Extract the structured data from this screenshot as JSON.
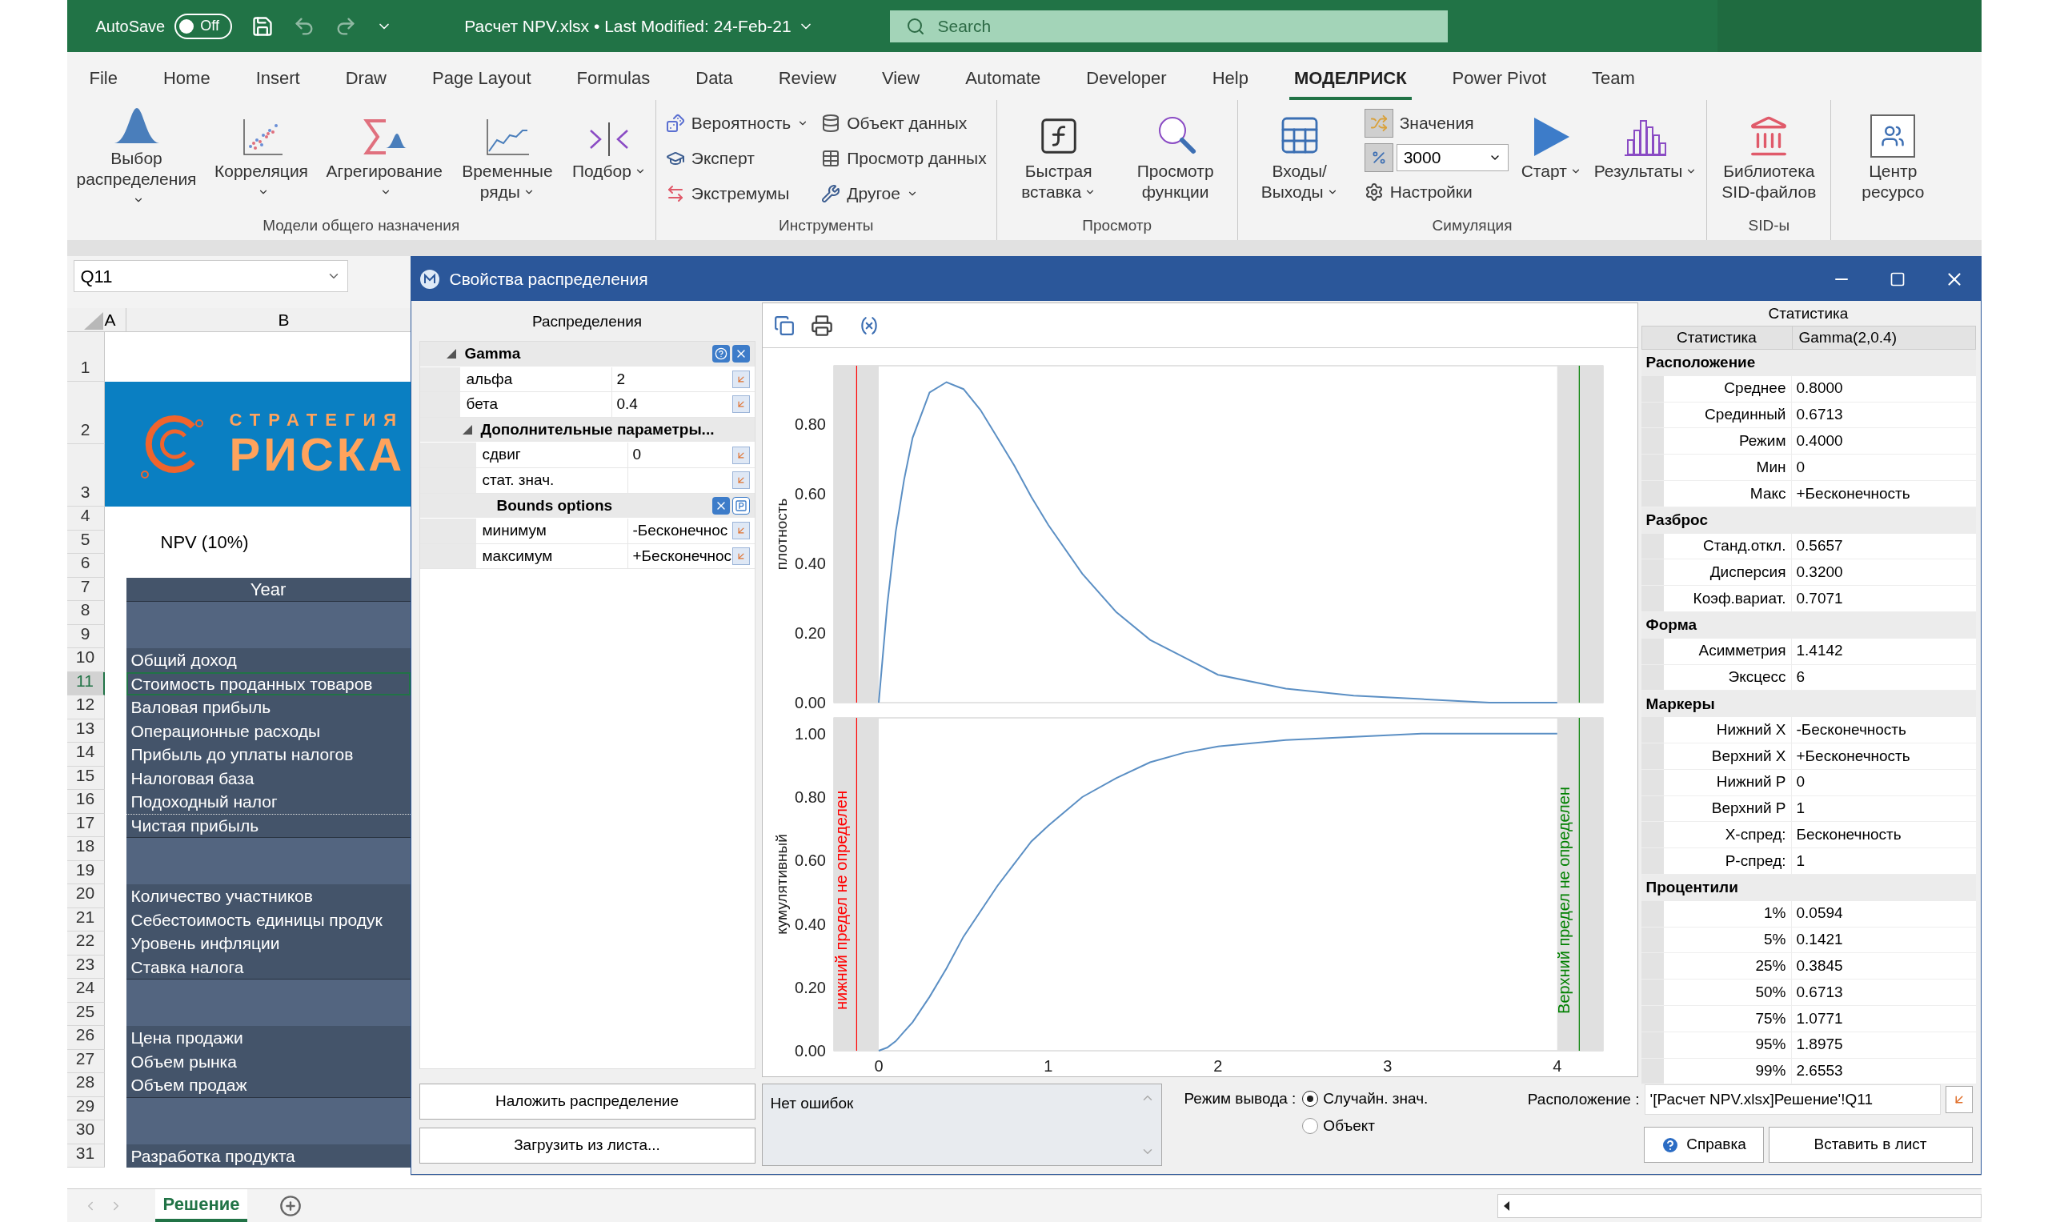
{
  "title_bar": {
    "autosave": {
      "label": "AutoSave",
      "toggle_text": "Off",
      "on": false
    },
    "title": "Расчет NPV.xlsx • Last Modified: 24-Feb-21",
    "search": {
      "placeholder": "Search"
    }
  },
  "menu_tabs": [
    {
      "label": "File",
      "selected": false
    },
    {
      "label": "Home",
      "selected": false
    },
    {
      "label": "Insert",
      "selected": false
    },
    {
      "label": "Draw",
      "selected": false
    },
    {
      "label": "Page Layout",
      "selected": false
    },
    {
      "label": "Formulas",
      "selected": false
    },
    {
      "label": "Data",
      "selected": false
    },
    {
      "label": "Review",
      "selected": false
    },
    {
      "label": "View",
      "selected": false
    },
    {
      "label": "Automate",
      "selected": false
    },
    {
      "label": "Developer",
      "selected": false
    },
    {
      "label": "Help",
      "selected": false
    },
    {
      "label": "МОДЕЛРИСК",
      "selected": true
    },
    {
      "label": "Power Pivot",
      "selected": false
    },
    {
      "label": "Team",
      "selected": false
    }
  ],
  "ribbon": [
    {
      "label": "Модели общего назначения",
      "items": [
        {
          "kind": "large",
          "label": "Выбор распределения",
          "dropdown": true
        },
        {
          "kind": "large",
          "label": "Корреляция",
          "dropdown": true
        },
        {
          "kind": "large",
          "label": "Агрегирование",
          "dropdown": true
        },
        {
          "kind": "large",
          "label": "Временные ряды",
          "dropdown": true
        },
        {
          "kind": "large",
          "label": "Подбор",
          "dropdown": true
        }
      ]
    },
    {
      "label": "Инструменты",
      "items": [
        {
          "kind": "small",
          "label": "Вероятность",
          "dropdown": true
        },
        {
          "kind": "small",
          "label": "Эксперт",
          "dropdown": false
        },
        {
          "kind": "small",
          "label": "Экстремумы",
          "dropdown": false
        },
        {
          "kind": "small",
          "label": "Объект данных",
          "dropdown": false
        },
        {
          "kind": "small",
          "label": "Просмотр данных",
          "dropdown": false
        },
        {
          "kind": "small",
          "label": "Другое",
          "dropdown": true
        }
      ]
    },
    {
      "label": "Просмотр",
      "items": [
        {
          "kind": "large",
          "label": "Быстрая вставка",
          "dropdown": true
        },
        {
          "kind": "large",
          "label": "Просмотр функции",
          "dropdown": false
        }
      ]
    },
    {
      "label": "Симуляция",
      "items": [
        {
          "kind": "large",
          "label": "Входы/ Выходы",
          "dropdown": true
        },
        {
          "kind": "small",
          "label": "Значения",
          "dropdown": false
        },
        {
          "kind": "select",
          "value": "3000"
        },
        {
          "kind": "small",
          "label": "Настройки",
          "dropdown": false
        },
        {
          "kind": "large",
          "label": "Старт",
          "dropdown": true
        },
        {
          "kind": "large",
          "label": "Результаты",
          "dropdown": true
        }
      ]
    },
    {
      "label": "SID-ы",
      "items": [
        {
          "kind": "large",
          "label": "Библиотека SID-файлов",
          "dropdown": false
        }
      ]
    },
    {
      "items": [
        {
          "kind": "large",
          "label": "Центр ресурсо",
          "dropdown": false
        }
      ]
    }
  ],
  "name_box": {
    "value": "Q11"
  },
  "sheet": {
    "columns": [
      "A",
      "B"
    ],
    "rows": [
      {
        "numbers": [
          "1"
        ],
        "kind": "blank",
        "selected": false
      },
      {
        "numbers": [
          "2",
          "3"
        ],
        "kind": "logo",
        "lines": [
          "СТРАТЕГИЯ",
          "РИСКА"
        ],
        "selected": false
      },
      {
        "numbers": [
          "4"
        ],
        "kind": "blank",
        "selected": false
      },
      {
        "numbers": [
          "5"
        ],
        "kind": "text",
        "text": "NPV (10%)",
        "selected": false
      },
      {
        "numbers": [
          "6"
        ],
        "kind": "blank",
        "selected": false
      },
      {
        "numbers": [
          "7"
        ],
        "kind": "header",
        "text": "Year",
        "selected": false
      },
      {
        "numbers": [
          "8",
          "9"
        ],
        "kind": "band",
        "selected": false
      },
      {
        "numbers": [
          "10"
        ],
        "kind": "item",
        "text": "Общий доход",
        "selected": false
      },
      {
        "numbers": [
          "11"
        ],
        "kind": "item",
        "text": "Стоимость проданных товаров",
        "selected": true
      },
      {
        "numbers": [
          "12"
        ],
        "kind": "item",
        "text": "Валовая прибыль",
        "selected": false
      },
      {
        "numbers": [
          "13"
        ],
        "kind": "item",
        "text": "Операционные расходы",
        "selected": false
      },
      {
        "numbers": [
          "14"
        ],
        "kind": "item",
        "text": "Прибыль до уплаты налогов",
        "selected": false
      },
      {
        "numbers": [
          "15"
        ],
        "kind": "item",
        "text": "Налоговая база",
        "selected": false
      },
      {
        "numbers": [
          "16"
        ],
        "kind": "item",
        "text": "Подоходный налог",
        "selected": false
      },
      {
        "numbers": [
          "17"
        ],
        "kind": "total",
        "text": "Чистая прибыль",
        "selected": false
      },
      {
        "numbers": [
          "18",
          "19"
        ],
        "kind": "band",
        "selected": false
      },
      {
        "numbers": [
          "20"
        ],
        "kind": "item",
        "text": "Количество участников",
        "selected": false
      },
      {
        "numbers": [
          "21"
        ],
        "kind": "item",
        "text": "Себестоимость единицы продук",
        "selected": false
      },
      {
        "numbers": [
          "22"
        ],
        "kind": "item",
        "text": "Уровень инфляции",
        "selected": false
      },
      {
        "numbers": [
          "23"
        ],
        "kind": "item",
        "text": "Ставка налога",
        "selected": false
      },
      {
        "numbers": [
          "24",
          "25"
        ],
        "kind": "band",
        "selected": false
      },
      {
        "numbers": [
          "26"
        ],
        "kind": "item",
        "text": "Цена продажи",
        "selected": false
      },
      {
        "numbers": [
          "27"
        ],
        "kind": "item",
        "text": "Объем рынка",
        "selected": false
      },
      {
        "numbers": [
          "28"
        ],
        "kind": "item",
        "text": "Объем продаж",
        "selected": false
      },
      {
        "numbers": [
          "29",
          "30"
        ],
        "kind": "band",
        "selected": false
      },
      {
        "numbers": [
          "31"
        ],
        "kind": "item",
        "text": "Разработка продукта",
        "selected": false
      }
    ]
  },
  "sheet_tabs": [
    {
      "label": "Решение",
      "selected": true
    }
  ],
  "dialog": {
    "title": "Свойства распределения",
    "distributions": {
      "title": "Распределения",
      "grid": [
        {
          "kind": "group",
          "label": "Gamma",
          "expanded": true,
          "children": [
            {
              "kind": "param",
              "label": "альфа",
              "value": "2"
            },
            {
              "kind": "param",
              "label": "бета",
              "value": "0.4"
            },
            {
              "kind": "group",
              "label": "Дополнительные параметры...",
              "expanded": true,
              "children": [
                {
                  "kind": "param",
                  "label": "сдвиг",
                  "value": "0"
                },
                {
                  "kind": "param",
                  "label": "стат. знач."
                },
                {
                  "kind": "section",
                  "label": "Bounds options"
                },
                {
                  "kind": "param",
                  "label": "минимум",
                  "value": "-Бесконечнос"
                },
                {
                  "kind": "param",
                  "label": "максимум",
                  "value": "+Бесконечнос"
                }
              ]
            }
          ]
        }
      ],
      "buttons": [
        "Наложить распределение",
        "Загрузить из листа..."
      ]
    },
    "density_plot": {
      "chart_data": {
        "type": "line",
        "ylabel": "плотность",
        "x": [
          0,
          0.05,
          0.1,
          0.15,
          0.2,
          0.3,
          0.4,
          0.5,
          0.6,
          0.7,
          0.8,
          0.9,
          1,
          1.2,
          1.4,
          1.6,
          1.8,
          2,
          2.4,
          2.8,
          3.2,
          3.6,
          4
        ],
        "xlim": [
          -0.264,
          4.27
        ],
        "ylim": [
          0,
          0.967
        ],
        "series": [
          {
            "color": "#5b8fc4",
            "values": [
              0,
              0.28,
              0.49,
              0.64,
              0.76,
              0.89,
              0.92,
              0.9,
              0.84,
              0.76,
              0.68,
              0.59,
              0.51,
              0.37,
              0.26,
              0.18,
              0.13,
              0.08,
              0.04,
              0.02,
              0.01,
              0,
              0
            ]
          }
        ],
        "yticks": [
          {
            "value": 0.8,
            "label": "0.80"
          },
          {
            "value": 0.6,
            "label": "0.60"
          },
          {
            "value": 0.4,
            "label": "0.40"
          },
          {
            "value": 0.2,
            "label": "0.20"
          },
          {
            "value": 0,
            "label": "0.00"
          }
        ],
        "ref_lines": [
          {
            "axis": "x",
            "value": -0.13,
            "color": "#ff0000"
          },
          {
            "axis": "x",
            "value": 4.13,
            "color": "#008000"
          }
        ]
      }
    },
    "cumulative_plot": {
      "chart_data": {
        "type": "line",
        "ylabel": "кумулятивный",
        "x": [
          0,
          0.05,
          0.1,
          0.15,
          0.2,
          0.3,
          0.4,
          0.5,
          0.6,
          0.7,
          0.8,
          0.9,
          1,
          1.2,
          1.4,
          1.6,
          1.8,
          2,
          2.4,
          2.8,
          3.2,
          3.6,
          4
        ],
        "xlim": [
          -0.264,
          4.27
        ],
        "ylim": [
          0,
          1.05
        ],
        "series": [
          {
            "color": "#5b8fc4",
            "values": [
              0,
              0.01,
              0.03,
              0.06,
              0.09,
              0.17,
              0.26,
              0.36,
              0.44,
              0.52,
              0.59,
              0.66,
              0.71,
              0.8,
              0.86,
              0.91,
              0.94,
              0.96,
              0.98,
              0.99,
              1,
              1,
              1
            ]
          }
        ],
        "xticks": [
          0,
          1,
          2,
          3,
          4
        ],
        "yticks": [
          {
            "value": 1,
            "label": "1.00"
          },
          {
            "value": 0.8,
            "label": "0.80"
          },
          {
            "value": 0.6,
            "label": "0.60"
          },
          {
            "value": 0.4,
            "label": "0.40"
          },
          {
            "value": 0.2,
            "label": "0.20"
          },
          {
            "value": 0,
            "label": "0.00"
          }
        ],
        "ref_lines": [
          {
            "axis": "x",
            "value": -0.13,
            "color": "#ff0000"
          },
          {
            "axis": "x",
            "value": 4.13,
            "color": "#008000"
          }
        ],
        "annotations": [
          "нижний предел не определен",
          "Верхний предел не определен"
        ]
      }
    },
    "messages": {
      "text": "Нет ошибок"
    },
    "output_mode": {
      "label": "Режим вывода :",
      "options": [
        {
          "label": "Случайн. знач.",
          "selected": true
        },
        {
          "label": "Объект",
          "selected": false
        }
      ]
    },
    "location": {
      "label": "Расположение :",
      "value": "'[Расчет NPV.xlsx]Решение'!Q11"
    },
    "help_button": "Справка",
    "insert_button": "Вставить в лист",
    "stats": {
      "title": "Статистика",
      "columns": [
        "Статистика",
        "Gamma(2,0.4)"
      ],
      "sections": [
        {
          "label": "Расположение",
          "rows": [
            {
              "label": "Среднее",
              "value": "0.8000"
            },
            {
              "label": "Срединный",
              "value": "0.6713"
            },
            {
              "label": "Режим",
              "value": "0.4000"
            },
            {
              "label": "Мин",
              "value": "0"
            },
            {
              "label": "Макс",
              "value": "+Бесконечность"
            }
          ]
        },
        {
          "label": "Разброс",
          "rows": [
            {
              "label": "Станд.откл.",
              "value": "0.5657"
            },
            {
              "label": "Дисперсия",
              "value": "0.3200"
            },
            {
              "label": "Коэф.вариат.",
              "value": "0.7071"
            }
          ]
        },
        {
          "label": "Форма",
          "rows": [
            {
              "label": "Асимметрия",
              "value": "1.4142"
            },
            {
              "label": "Эксцесс",
              "value": "6"
            }
          ]
        },
        {
          "label": "Маркеры",
          "rows": [
            {
              "label": "Нижний X",
              "value": "-Бесконечность"
            },
            {
              "label": "Верхний X",
              "value": "+Бесконечность"
            },
            {
              "label": "Нижний P",
              "value": "0"
            },
            {
              "label": "Верхний P",
              "value": "1"
            },
            {
              "label": "X-спред:",
              "value": "Бесконечность"
            },
            {
              "label": "P-спред:",
              "value": "1"
            }
          ]
        },
        {
          "label": "Процентили",
          "rows": [
            {
              "label": "1%",
              "value": "0.0594"
            },
            {
              "label": "5%",
              "value": "0.1421"
            },
            {
              "label": "25%",
              "value": "0.3845"
            },
            {
              "label": "50%",
              "value": "0.6713"
            },
            {
              "label": "75%",
              "value": "1.0771"
            },
            {
              "label": "95%",
              "value": "1.8975"
            },
            {
              "label": "99%",
              "value": "2.6553"
            }
          ]
        }
      ]
    }
  }
}
